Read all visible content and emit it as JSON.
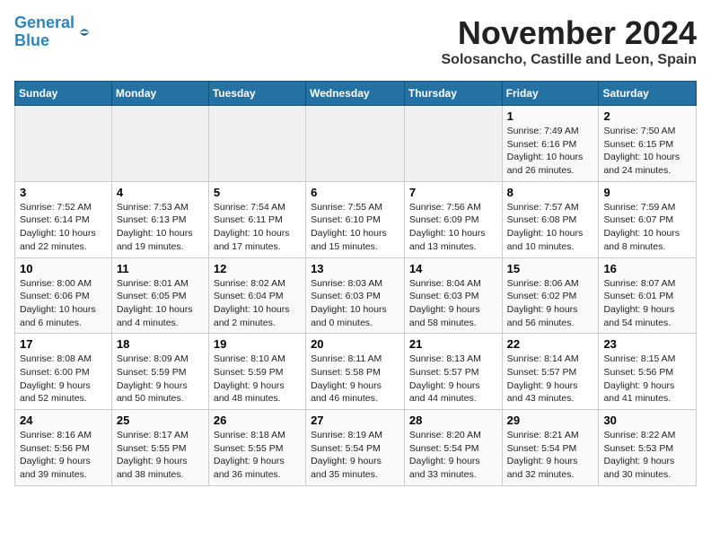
{
  "header": {
    "logo_line1": "General",
    "logo_line2": "Blue",
    "month_title": "November 2024",
    "subtitle": "Solosancho, Castille and Leon, Spain"
  },
  "weekdays": [
    "Sunday",
    "Monday",
    "Tuesday",
    "Wednesday",
    "Thursday",
    "Friday",
    "Saturday"
  ],
  "weeks": [
    [
      {
        "day": "",
        "info": ""
      },
      {
        "day": "",
        "info": ""
      },
      {
        "day": "",
        "info": ""
      },
      {
        "day": "",
        "info": ""
      },
      {
        "day": "",
        "info": ""
      },
      {
        "day": "1",
        "info": "Sunrise: 7:49 AM\nSunset: 6:16 PM\nDaylight: 10 hours and 26 minutes."
      },
      {
        "day": "2",
        "info": "Sunrise: 7:50 AM\nSunset: 6:15 PM\nDaylight: 10 hours and 24 minutes."
      }
    ],
    [
      {
        "day": "3",
        "info": "Sunrise: 7:52 AM\nSunset: 6:14 PM\nDaylight: 10 hours and 22 minutes."
      },
      {
        "day": "4",
        "info": "Sunrise: 7:53 AM\nSunset: 6:13 PM\nDaylight: 10 hours and 19 minutes."
      },
      {
        "day": "5",
        "info": "Sunrise: 7:54 AM\nSunset: 6:11 PM\nDaylight: 10 hours and 17 minutes."
      },
      {
        "day": "6",
        "info": "Sunrise: 7:55 AM\nSunset: 6:10 PM\nDaylight: 10 hours and 15 minutes."
      },
      {
        "day": "7",
        "info": "Sunrise: 7:56 AM\nSunset: 6:09 PM\nDaylight: 10 hours and 13 minutes."
      },
      {
        "day": "8",
        "info": "Sunrise: 7:57 AM\nSunset: 6:08 PM\nDaylight: 10 hours and 10 minutes."
      },
      {
        "day": "9",
        "info": "Sunrise: 7:59 AM\nSunset: 6:07 PM\nDaylight: 10 hours and 8 minutes."
      }
    ],
    [
      {
        "day": "10",
        "info": "Sunrise: 8:00 AM\nSunset: 6:06 PM\nDaylight: 10 hours and 6 minutes."
      },
      {
        "day": "11",
        "info": "Sunrise: 8:01 AM\nSunset: 6:05 PM\nDaylight: 10 hours and 4 minutes."
      },
      {
        "day": "12",
        "info": "Sunrise: 8:02 AM\nSunset: 6:04 PM\nDaylight: 10 hours and 2 minutes."
      },
      {
        "day": "13",
        "info": "Sunrise: 8:03 AM\nSunset: 6:03 PM\nDaylight: 10 hours and 0 minutes."
      },
      {
        "day": "14",
        "info": "Sunrise: 8:04 AM\nSunset: 6:03 PM\nDaylight: 9 hours and 58 minutes."
      },
      {
        "day": "15",
        "info": "Sunrise: 8:06 AM\nSunset: 6:02 PM\nDaylight: 9 hours and 56 minutes."
      },
      {
        "day": "16",
        "info": "Sunrise: 8:07 AM\nSunset: 6:01 PM\nDaylight: 9 hours and 54 minutes."
      }
    ],
    [
      {
        "day": "17",
        "info": "Sunrise: 8:08 AM\nSunset: 6:00 PM\nDaylight: 9 hours and 52 minutes."
      },
      {
        "day": "18",
        "info": "Sunrise: 8:09 AM\nSunset: 5:59 PM\nDaylight: 9 hours and 50 minutes."
      },
      {
        "day": "19",
        "info": "Sunrise: 8:10 AM\nSunset: 5:59 PM\nDaylight: 9 hours and 48 minutes."
      },
      {
        "day": "20",
        "info": "Sunrise: 8:11 AM\nSunset: 5:58 PM\nDaylight: 9 hours and 46 minutes."
      },
      {
        "day": "21",
        "info": "Sunrise: 8:13 AM\nSunset: 5:57 PM\nDaylight: 9 hours and 44 minutes."
      },
      {
        "day": "22",
        "info": "Sunrise: 8:14 AM\nSunset: 5:57 PM\nDaylight: 9 hours and 43 minutes."
      },
      {
        "day": "23",
        "info": "Sunrise: 8:15 AM\nSunset: 5:56 PM\nDaylight: 9 hours and 41 minutes."
      }
    ],
    [
      {
        "day": "24",
        "info": "Sunrise: 8:16 AM\nSunset: 5:56 PM\nDaylight: 9 hours and 39 minutes."
      },
      {
        "day": "25",
        "info": "Sunrise: 8:17 AM\nSunset: 5:55 PM\nDaylight: 9 hours and 38 minutes."
      },
      {
        "day": "26",
        "info": "Sunrise: 8:18 AM\nSunset: 5:55 PM\nDaylight: 9 hours and 36 minutes."
      },
      {
        "day": "27",
        "info": "Sunrise: 8:19 AM\nSunset: 5:54 PM\nDaylight: 9 hours and 35 minutes."
      },
      {
        "day": "28",
        "info": "Sunrise: 8:20 AM\nSunset: 5:54 PM\nDaylight: 9 hours and 33 minutes."
      },
      {
        "day": "29",
        "info": "Sunrise: 8:21 AM\nSunset: 5:54 PM\nDaylight: 9 hours and 32 minutes."
      },
      {
        "day": "30",
        "info": "Sunrise: 8:22 AM\nSunset: 5:53 PM\nDaylight: 9 hours and 30 minutes."
      }
    ]
  ]
}
